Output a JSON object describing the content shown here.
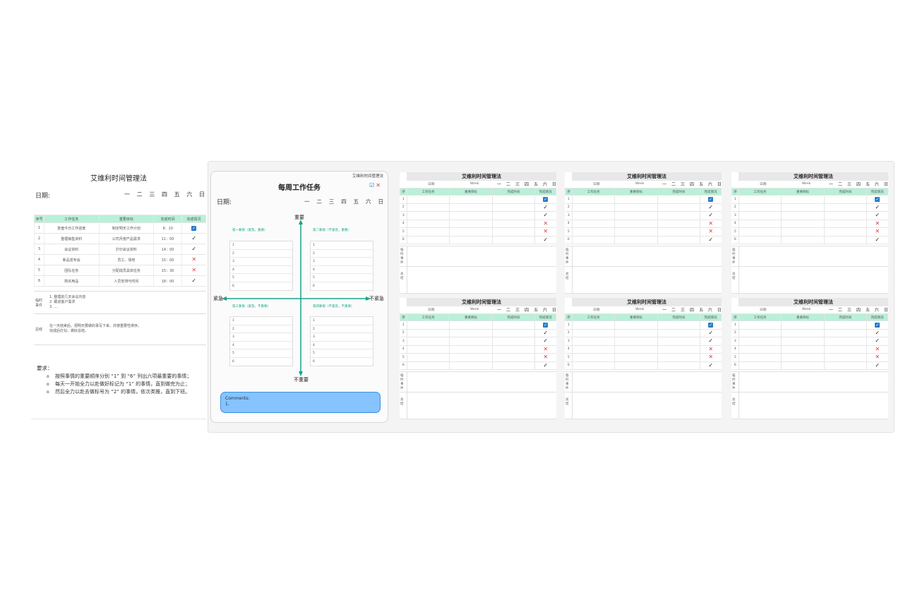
{
  "main_sheet": {
    "title": "艾维利时间管理法",
    "date_label": "日期:",
    "weekdays": [
      "一",
      "二",
      "三",
      "四",
      "五",
      "六",
      "日"
    ],
    "columns": [
      "序号",
      "工作任务",
      "重要目标",
      "完成时间",
      "完成情况"
    ],
    "rows": [
      {
        "no": "1",
        "task": "复盘今日工作进度",
        "goal": "制定明天工作计划",
        "time": "9：10",
        "status": "checkbox"
      },
      {
        "no": "2",
        "task": "整理销售资料",
        "goal": "公司月度产品需求",
        "time": "11：00",
        "status": "check"
      },
      {
        "no": "3",
        "task": "会议资料",
        "goal": "打印会议资料",
        "time": "14：00",
        "status": "check"
      },
      {
        "no": "4",
        "task": "新品发布会",
        "goal": "员工、场地",
        "time": "15：00",
        "status": "cross"
      },
      {
        "no": "5",
        "task": "团队任务",
        "goal": "分配成员具体任务",
        "time": "15：30",
        "status": "cross"
      },
      {
        "no": "6",
        "task": "购买用品",
        "goal": "人员安排与时间",
        "time": "18：00",
        "status": "check"
      }
    ],
    "foot1_label": "临时事件",
    "foot1_lines": [
      "1. 整理前几天会议内容",
      "2. 跟进客户需求",
      "3. ..."
    ],
    "foot2_label": "总结",
    "foot2_lines": [
      "在一天结束后，把明天要做的事写下来，并按重要性排序。",
      "完成后打勾，做好总结。"
    ],
    "req_title": "要求：",
    "requirements": [
      "按照事情的重要顺序分别 “1” 到 “6” 列出六项最重要的事情；",
      "每天一开始全力以赴做好标记为 “1” 的事情，直到做完为止；",
      "然后全力以赴去做标号为 “2” 的事情，依次类推，直到下班。"
    ]
  },
  "quadrant": {
    "brand": "艾维利时间管理法",
    "title": "每周工作任务",
    "date_label": "日期:",
    "weekdays": [
      "一",
      "二",
      "三",
      "四",
      "五",
      "六",
      "日"
    ],
    "important": "重要",
    "not_important": "不重要",
    "urgent": "紧急",
    "not_urgent": "不紧急",
    "q1": "第一象限（紧急，重要）",
    "q2": "第二象限（不紧急，重要）",
    "q3": "第三象限（紧急，不重要）",
    "q4": "第四象限（不紧急，不重要）",
    "list_numbers": [
      "1",
      "2",
      "3",
      "4",
      "5",
      "6"
    ],
    "comment_title": "Comments:",
    "comment_line": "1."
  },
  "mini_sheets": {
    "title": "艾维利时间管理法",
    "date_label": "日期:",
    "week_label": "Week",
    "weekdays": [
      "一",
      "二",
      "三",
      "四",
      "五",
      "六",
      "日"
    ],
    "columns": [
      "序",
      "工作任务",
      "重要目标",
      "完成时间",
      "完成情况"
    ],
    "row_numbers": [
      "1",
      "2",
      "3",
      "4",
      "5",
      "6"
    ],
    "statuses": [
      "checkbox",
      "check",
      "check",
      "cross",
      "cross",
      "check"
    ],
    "foot1_label": "临时事件",
    "foot2_label": "总结"
  },
  "colors": {
    "header_mint": "#b8f0d8",
    "quadrant_green": "#17a58a",
    "comment_blue": "#86c3ff",
    "cross_red": "#e23b3b",
    "checkbox_blue": "#2a7ac9"
  }
}
